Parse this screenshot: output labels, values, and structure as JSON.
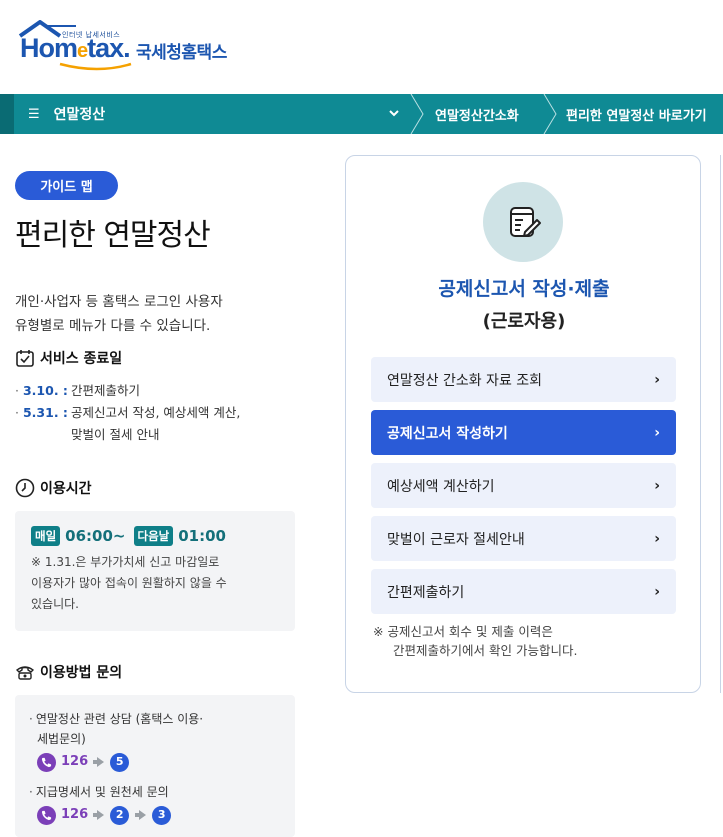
{
  "header": {
    "logo_sub": "인터넷 납세서비스",
    "logo_home": "Hom",
    "logo_e": "e",
    "logo_tax": "tax.",
    "logo_kor": "국세청홈택스"
  },
  "nav": {
    "menu_label": "연말정산",
    "link1": "연말정산간소화",
    "link2": "편리한 연말정산 바로가기"
  },
  "guide_badge": "가이드 맵",
  "page_title": "편리한 연말정산",
  "intro_line1": "개인·사업자 등 홈택스 로그인 사용자",
  "intro_line2": "유형별로 메뉴가 다를 수 있습니다.",
  "service_end": {
    "title": "서비스 종료일",
    "items": [
      {
        "date": "3.10. :",
        "text": "간편제출하기"
      },
      {
        "date": "5.31. :",
        "text_line1": "공제신고서 작성, 예상세액 계산,",
        "text_line2": "맞벌이 절세 안내"
      }
    ]
  },
  "usage_time": {
    "title": "이용시간",
    "tag1": "매일",
    "start": "06:00~",
    "tag2": "다음날",
    "end": "01:00",
    "note_line1": "※ 1.31.은 부가가치세 신고 마감일로",
    "note_line2": "이용자가 많아 접속이 원활하지 않을 수",
    "note_line3": "있습니다."
  },
  "inquiry": {
    "title": "이용방법 문의",
    "items": [
      {
        "text_line1": "연말정산 관련 상담 (홈택스 이용·",
        "text_line2": "세법문의)",
        "phone": "126",
        "steps": [
          "5"
        ]
      },
      {
        "text_line1": "지급명세서 및 원천세 문의",
        "phone": "126",
        "steps": [
          "2",
          "3"
        ]
      }
    ]
  },
  "card": {
    "title": "공제신고서 작성·제출",
    "subtitle": "(근로자용)",
    "menu": [
      {
        "label": "연말정산 간소화 자료 조회",
        "active": false
      },
      {
        "label": "공제신고서 작성하기",
        "active": true
      },
      {
        "label": "예상세액 계산하기",
        "active": false
      },
      {
        "label": "맞벌이 근로자 절세안내",
        "active": false
      },
      {
        "label": "간편제출하기",
        "active": false
      }
    ],
    "note_line1": "※ 공제신고서 회수 및 제출 이력은",
    "note_line2": "간편제출하기에서 확인 가능합니다."
  },
  "colors": {
    "nav_teal": "#0f8a94",
    "brand_blue": "#1c56b0",
    "accent_blue": "#2a5bd7",
    "phone_purple": "#7b3fb8"
  }
}
